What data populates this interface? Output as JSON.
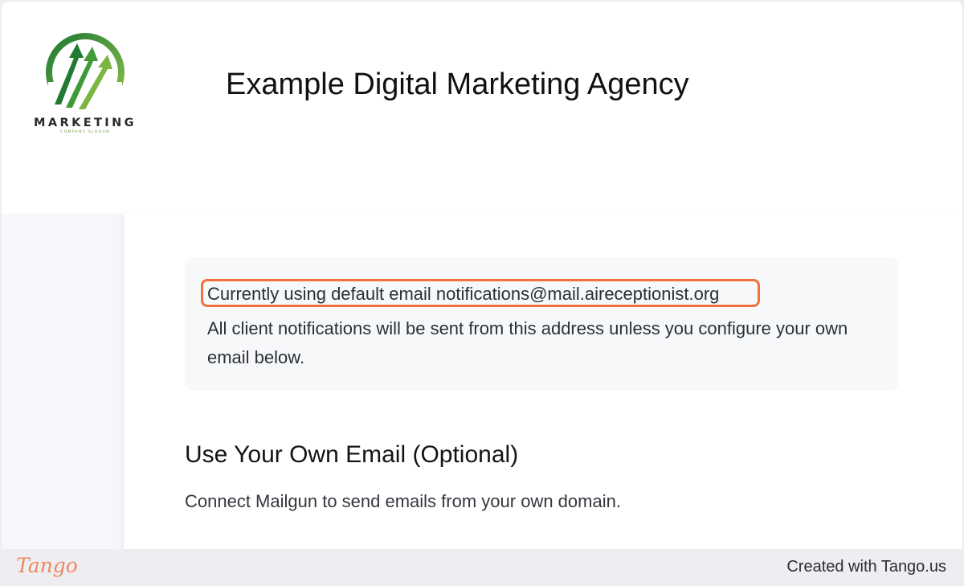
{
  "header": {
    "logo": {
      "word": "MARKETING",
      "slogan": "COMPANY SLOGAN",
      "icon": "arrows-circle-logo-icon",
      "color": "#3f9b3a"
    },
    "title": "Example Digital Marketing Agency"
  },
  "notice": {
    "current": "Currently using default email notifications@mail.aireceptionist.org",
    "body": "All client notifications will be sent from this address unless you configure your own email below.",
    "highlight_color": "#f2713f"
  },
  "section": {
    "title": "Use Your Own Email (Optional)",
    "description": "Connect Mailgun to send emails from your own domain."
  },
  "footer": {
    "brand": "Tango",
    "credit": "Created with Tango.us"
  }
}
